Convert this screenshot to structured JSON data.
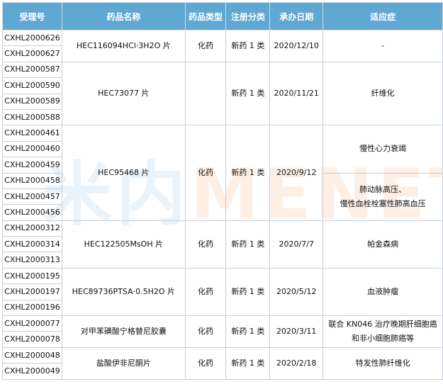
{
  "headers": [
    "受理号",
    "药品名称",
    "药品类型",
    "注册分类",
    "承办日期",
    "适应症"
  ],
  "watermark": {
    "prefix": "米内",
    "brand": "MENET"
  },
  "groups": [
    {
      "ids": [
        "CXHL2000626",
        "CXHL2000627"
      ],
      "name": "HEC116094HCl·3H2O 片",
      "type": "化药",
      "class": "新药 1 类",
      "date": "2020/12/10",
      "indications": [
        "-"
      ]
    },
    {
      "ids": [
        "CXHL2000587",
        "CXHL2000590",
        "CXHL2000589",
        "CXHL2000588"
      ],
      "name": "HEC73077 片",
      "type": "",
      "class": "新药 1 类",
      "date": "2020/11/21",
      "indications": [
        "纤维化"
      ]
    },
    {
      "ids": [
        "CXHL2000461",
        "CXHL2000460",
        "CXHL2000459",
        "CXHL2000458",
        "CXHL2000457",
        "CXHL2000456"
      ],
      "name": "HEC95468 片",
      "type": "化药",
      "class": "新药 1 类",
      "date": "2020/9/12",
      "indications": [
        "慢性心力衰竭",
        "肺动脉高压、\n慢性血栓栓塞性肺高血压"
      ]
    },
    {
      "ids": [
        "CXHL2000312",
        "CXHL2000314",
        "CXHL2000313"
      ],
      "name": "HEC122505MsOH 片",
      "type": "化药",
      "class": "新药 1 类",
      "date": "2020/7/7",
      "indications": [
        "帕金森病"
      ]
    },
    {
      "ids": [
        "CXHL2000195",
        "CXHL2000197",
        "CXHL2000196"
      ],
      "name": "HEC89736PTSA·0.5H2O 片",
      "type": "化药",
      "class": "新药 1 类",
      "date": "2020/5/12",
      "indications": [
        "血液肿瘤"
      ]
    },
    {
      "ids": [
        "CXHL2000077",
        "CXHL2000078"
      ],
      "name": "对甲苯磺酸宁格替尼胶囊",
      "type": "化药",
      "class": "新药 1 类",
      "date": "2020/3/11",
      "indications": [
        "联合 KN046 治疗晚期肝细胞癌\n和非小细胞肺癌等"
      ]
    },
    {
      "ids": [
        "CXHL2000048",
        "CXHL2000049"
      ],
      "name": "盐酸伊非尼酮片",
      "type": "化药",
      "class": "新药 1 类",
      "date": "2020/2/18",
      "indications": [
        "特发性肺纤维化"
      ]
    }
  ]
}
